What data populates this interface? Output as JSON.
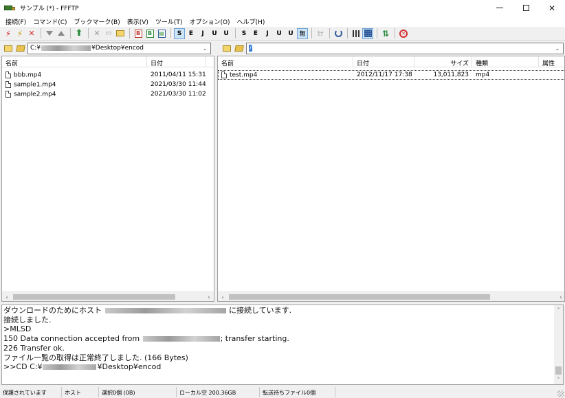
{
  "window": {
    "title": "サンプル (*) - FFFTP",
    "minimize": "─",
    "maximize": "□",
    "close": "✕"
  },
  "menu": [
    "接続(F)",
    "コマンド(C)",
    "ブックマーク(B)",
    "表示(V)",
    "ツール(T)",
    "オプション(O)",
    "ヘルプ(H)"
  ],
  "toolbar": {
    "b_red": "B",
    "b_green": "B",
    "s_ascii": "S",
    "e_euc": "E",
    "j_jis": "J",
    "u_utf8": "U",
    "u_utf8bom": "U",
    "s2": "S",
    "e2": "E",
    "j2": "J",
    "u2": "U",
    "u3": "U",
    "nothing": "無",
    "kana": "ｶﾅ"
  },
  "local": {
    "path_prefix": "C:¥",
    "path_suffix": "¥Desktop¥encod",
    "columns": {
      "name": "名前",
      "date": "日付"
    },
    "files": [
      {
        "name": "bbb.mp4",
        "date": "2011/04/11 15:31"
      },
      {
        "name": "sample1.mp4",
        "date": "2021/03/30 11:44"
      },
      {
        "name": "sample2.mp4",
        "date": "2021/03/30 11:02"
      }
    ]
  },
  "remote": {
    "path": "/",
    "columns": {
      "name": "名前",
      "date": "日付",
      "size": "サイズ",
      "type": "種類",
      "attr": "属性"
    },
    "files": [
      {
        "name": "test.mp4",
        "date": "2012/11/17 17:38",
        "size": "13,011,823",
        "type": "mp4"
      }
    ]
  },
  "log": {
    "line1_prefix": "ダウンロードのためにホスト",
    "line1_suffix": "に接続しています.",
    "line2": "接続しました.",
    "line3": ">MLSD",
    "line4_prefix": "150 Data connection accepted from",
    "line4_suffix": "; transfer starting.",
    "line5": "226 Transfer ok.",
    "line6": "ファイル一覧の取得は正常終了しました. (166 Bytes)",
    "line7_prefix": ">>CD C:¥",
    "line7_suffix": "¥Desktop¥encod"
  },
  "status": {
    "connection": "保護されています",
    "host": "ホスト",
    "selection": "選択0個 (0B)",
    "local_free": "ローカル空 200.36GB",
    "queue": "転送待ちファイル0個"
  },
  "colors": {
    "selection_blue": "#3478d6",
    "stop_red": "#d12b2b",
    "accent_green": "#2c8a3c"
  }
}
